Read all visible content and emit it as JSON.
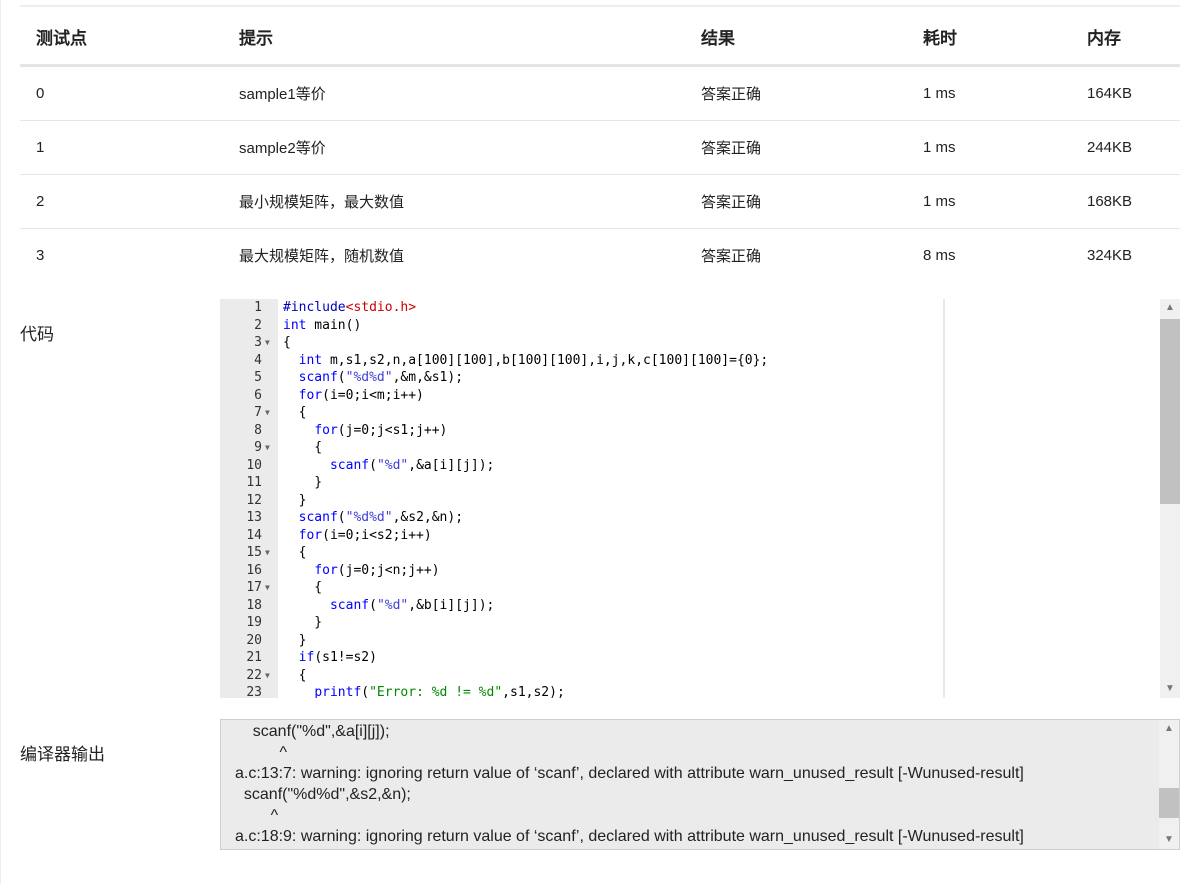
{
  "table": {
    "headers": [
      "测试点",
      "提示",
      "结果",
      "耗时",
      "内存"
    ],
    "rows": [
      {
        "id": "0",
        "hint": "sample1等价",
        "result": "答案正确",
        "time": "1 ms",
        "memory": "164KB"
      },
      {
        "id": "1",
        "hint": "sample2等价",
        "result": "答案正确",
        "time": "1 ms",
        "memory": "244KB"
      },
      {
        "id": "2",
        "hint": "最小规模矩阵，最大数值",
        "result": "答案正确",
        "time": "1 ms",
        "memory": "168KB"
      },
      {
        "id": "3",
        "hint": "最大规模矩阵，随机数值",
        "result": "答案正确",
        "time": "8 ms",
        "memory": "324KB"
      }
    ]
  },
  "code_section": {
    "label": "代码",
    "lines": [
      {
        "n": "1",
        "text": "#include<stdio.h>",
        "fold": false
      },
      {
        "n": "2",
        "text": "int main()",
        "fold": false
      },
      {
        "n": "3",
        "text": "{",
        "fold": true
      },
      {
        "n": "4",
        "text": "  int m,s1,s2,n,a[100][100],b[100][100],i,j,k,c[100][100]={0};",
        "fold": false
      },
      {
        "n": "5",
        "text": "  scanf(\"%d%d\",&m,&s1);",
        "fold": false
      },
      {
        "n": "6",
        "text": "  for(i=0;i<m;i++)",
        "fold": false
      },
      {
        "n": "7",
        "text": "  {",
        "fold": true
      },
      {
        "n": "8",
        "text": "    for(j=0;j<s1;j++)",
        "fold": false
      },
      {
        "n": "9",
        "text": "    {",
        "fold": true
      },
      {
        "n": "10",
        "text": "      scanf(\"%d\",&a[i][j]);",
        "fold": false
      },
      {
        "n": "11",
        "text": "    }",
        "fold": false
      },
      {
        "n": "12",
        "text": "  }",
        "fold": false
      },
      {
        "n": "13",
        "text": "  scanf(\"%d%d\",&s2,&n);",
        "fold": false
      },
      {
        "n": "14",
        "text": "  for(i=0;i<s2;i++)",
        "fold": false
      },
      {
        "n": "15",
        "text": "  {",
        "fold": true
      },
      {
        "n": "16",
        "text": "    for(j=0;j<n;j++)",
        "fold": false
      },
      {
        "n": "17",
        "text": "    {",
        "fold": true
      },
      {
        "n": "18",
        "text": "      scanf(\"%d\",&b[i][j]);",
        "fold": false
      },
      {
        "n": "19",
        "text": "    }",
        "fold": false
      },
      {
        "n": "20",
        "text": "  }",
        "fold": false
      },
      {
        "n": "21",
        "text": "  if(s1!=s2)",
        "fold": false
      },
      {
        "n": "22",
        "text": "  {",
        "fold": true
      },
      {
        "n": "23",
        "text": "    printf(\"Error: %d != %d\",s1,s2);",
        "fold": false
      }
    ]
  },
  "compiler_section": {
    "label": "编译器输出",
    "lines": [
      "    scanf(\"%d\",&a[i][j]);",
      "          ^",
      "a.c:13:7: warning: ignoring return value of ‘scanf’, declared with attribute warn_unused_result [-Wunused-result]",
      "  scanf(\"%d%d\",&s2,&n);",
      "        ^",
      "a.c:18:9: warning: ignoring return value of ‘scanf’, declared with attribute warn_unused_result [-Wunused-result]"
    ]
  },
  "icons": {
    "fold": "fold-arrow-icon",
    "scroll_up": "scroll-up-icon",
    "scroll_down": "scroll-down-icon"
  },
  "colors": {
    "result_ok": "#e74c3c",
    "keyword": "#0000ff",
    "string": "#3e3edc",
    "include": "#cc0000"
  }
}
